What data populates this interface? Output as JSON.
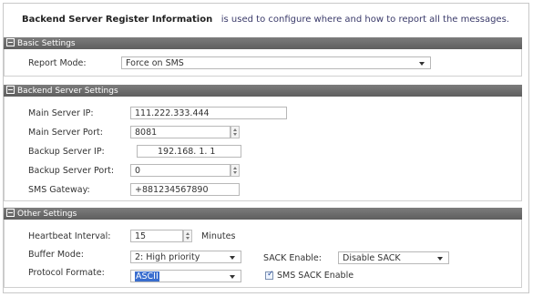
{
  "header": {
    "title": "Backend Server Register Information",
    "description": "is used to configure where and how to report all the messages."
  },
  "sections": {
    "basic": {
      "title": "Basic Settings",
      "report_mode": {
        "label": "Report Mode:",
        "value": "Force on SMS"
      }
    },
    "backend": {
      "title": "Backend Server Settings",
      "main_ip": {
        "label": "Main Server IP:",
        "value": "111.222.333.444"
      },
      "main_port": {
        "label": "Main Server Port:",
        "value": "8081"
      },
      "backup_ip": {
        "label": "Backup Server IP:",
        "value": "192.168. 1. 1"
      },
      "backup_port": {
        "label": "Backup Server Port:",
        "value": "0"
      },
      "sms_gateway": {
        "label": "SMS Gateway:",
        "value": "+881234567890"
      }
    },
    "other": {
      "title": "Other Settings",
      "heartbeat": {
        "label": "Heartbeat Interval:",
        "value": "15",
        "unit": "Minutes"
      },
      "buffer_mode": {
        "label": "Buffer Mode:",
        "value": "2: High priority"
      },
      "protocol": {
        "label": "Protocol Formate:",
        "value": "ASCII"
      },
      "sack_enable": {
        "label": "SACK Enable:",
        "value": "Disable SACK"
      },
      "sms_sack": {
        "label": "SMS SACK Enable",
        "checked": true
      }
    }
  },
  "colors": {
    "section_bar": "#6e6e6e",
    "selection": "#3a6ecf"
  }
}
